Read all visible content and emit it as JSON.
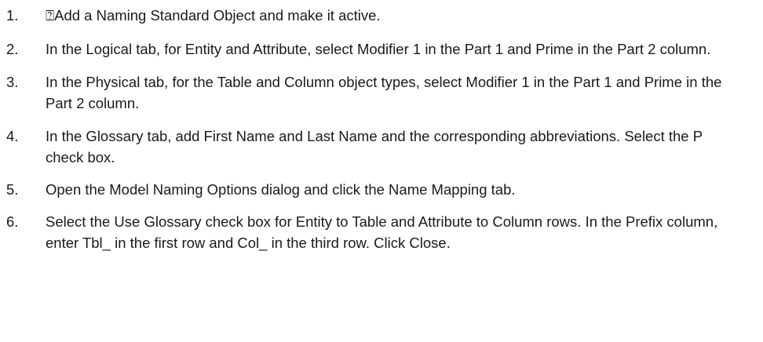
{
  "steps": [
    {
      "number": "1.",
      "text": "⍰Add a Naming Standard Object and make it active."
    },
    {
      "number": "2.",
      "text": "In the Logical tab, for Entity and Attribute, select Modifier 1 in the Part 1 and Prime in the Part 2 column."
    },
    {
      "number": "3.",
      "text": "In the Physical tab, for the Table and Column object types, select Modifier 1 in the Part 1 and Prime in the Part 2 column."
    },
    {
      "number": "4.",
      "text": "In the Glossary tab, add First Name and Last Name and the corresponding abbreviations. Select the P check box."
    },
    {
      "number": "5.",
      "text": "Open the Model Naming Options dialog and click the Name Mapping tab."
    },
    {
      "number": "6.",
      "text": "Select the Use Glossary check box for Entity to Table and Attribute to Column rows. In the Prefix column, enter Tbl_ in the first row and Col_ in the third row. Click Close."
    }
  ]
}
